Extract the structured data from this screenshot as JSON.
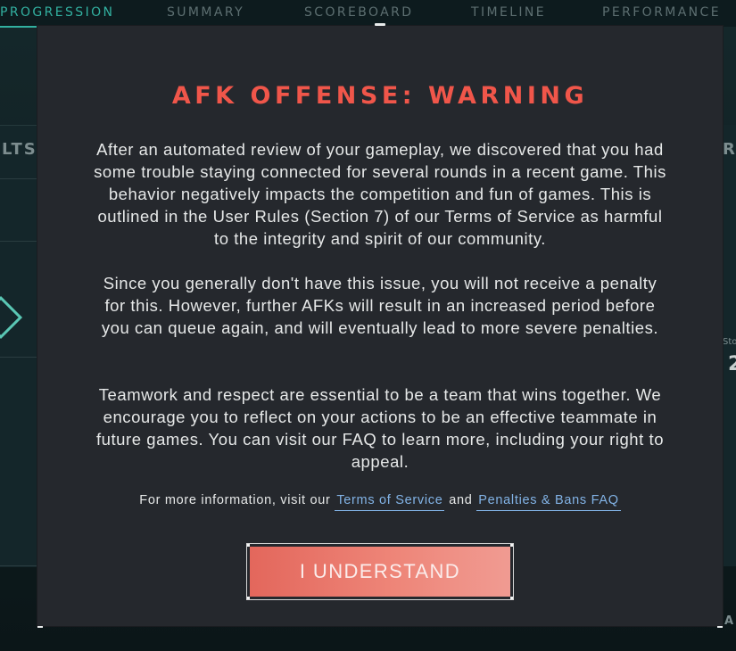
{
  "nav": {
    "tabs": [
      {
        "label": "PROGRESSION",
        "active": true
      },
      {
        "label": "SUMMARY",
        "active": false
      },
      {
        "label": "SCOREBOARD",
        "active": false
      },
      {
        "label": "TIMELINE",
        "active": false
      },
      {
        "label": "PERFORMANCE",
        "active": false
      }
    ]
  },
  "background": {
    "left_fragment": "LTS",
    "right_fragment": "RO",
    "right_small_fragment": "Sto",
    "right_number_fragment": "2",
    "right_bottom_fragment": "AL"
  },
  "modal": {
    "title": "AFK OFFENSE: WARNING",
    "paragraphs": [
      "After an automated review of your gameplay, we discovered that you had some trouble staying connected for several rounds in a recent game. This behavior negatively impacts the competition and fun of games. This is outlined in the User Rules (Section 7) of our Terms of Service as harmful to the integrity and spirit of our community.",
      "Since you generally don't have this issue, you will not receive a penalty for this. However, further AFKs will result in an increased period before you can queue again, and will eventually lead to more severe penalties.",
      "Teamwork and respect are essential to be a team that wins together. We encourage you to reflect on your actions to be an effective teammate in future games. You can visit our FAQ to learn more, including your right to appeal."
    ],
    "info_prefix": "For more information, visit our",
    "info_link_terms": "Terms of Service",
    "info_and": "and",
    "info_link_faq": "Penalties & Bans FAQ",
    "button_label": "I UNDERSTAND"
  },
  "colors": {
    "title": "#f0564a",
    "accent": "#32b0a0",
    "link": "#82b3e6",
    "button": "#ee8578",
    "modal_bg": "#25282d"
  }
}
